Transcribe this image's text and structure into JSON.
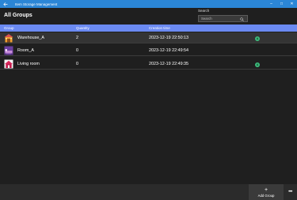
{
  "window": {
    "title": "Item Storage Management",
    "back_icon": "back-arrow-icon",
    "minimize_glyph": "–",
    "maximize_glyph": "□",
    "close_glyph": "✕"
  },
  "page": {
    "title": "All Groups"
  },
  "search": {
    "label": "Search",
    "placeholder": "Search",
    "icon": "search-icon"
  },
  "table": {
    "columns": {
      "group": "Group",
      "quantity": "Quantity",
      "creation_time": "Creation time"
    },
    "rows": [
      {
        "name": "Warehouse_A",
        "quantity": "2",
        "creation_time": "2023-12-19 22:50:13",
        "icon": "warehouse-icon",
        "badge": "A",
        "selected": true
      },
      {
        "name": "Room_A",
        "quantity": "0",
        "creation_time": "2023-12-19 22:49:54",
        "icon": "room-icon",
        "badge": "",
        "selected": false
      },
      {
        "name": "Living room",
        "quantity": "0",
        "creation_time": "2023-12-19 22:49:35",
        "icon": "living-room-icon",
        "badge": "A",
        "selected": false
      }
    ]
  },
  "toolbar": {
    "add_label": "Add Group",
    "add_glyph": "+",
    "more_glyph": "•••"
  },
  "colors": {
    "titlebar": "#2b86d6",
    "header": "#6b8af2",
    "badge": "#3dbb7c",
    "background": "#1f1f1f"
  }
}
